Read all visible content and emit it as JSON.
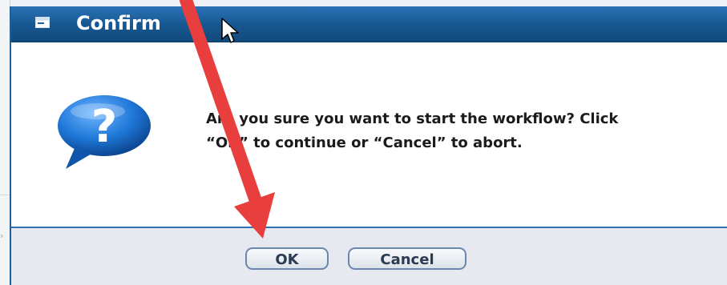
{
  "dialog": {
    "title": "Confirm",
    "icon": "question-icon",
    "message_line1": "Are you sure you want to start the workflow? Click",
    "message_line2": "“OK” to continue or “Cancel” to abort."
  },
  "buttons": {
    "ok_label": "OK",
    "cancel_label": "Cancel"
  },
  "colors": {
    "titlebar": "#16568f",
    "annotation_arrow": "#e83e3e",
    "button_border": "#6a88ad"
  }
}
